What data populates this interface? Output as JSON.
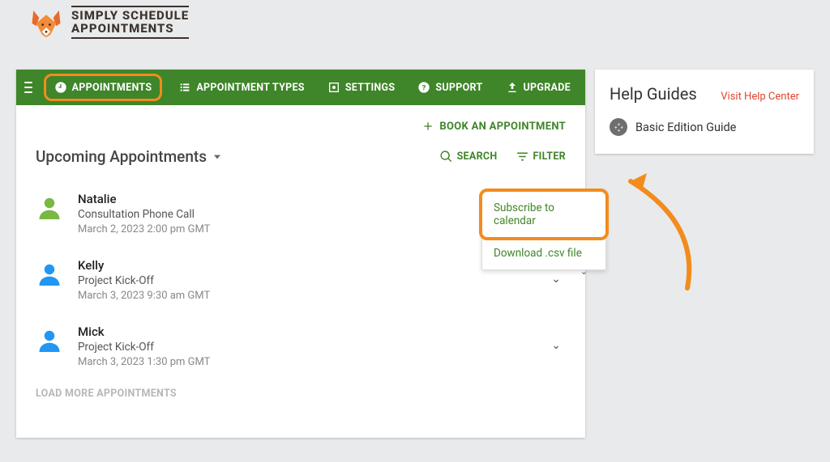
{
  "brand": {
    "line1": "SIMPLY SCHEDULE",
    "line2": "APPOINTMENTS"
  },
  "nav": {
    "appointments": "APPOINTMENTS",
    "types": "APPOINTMENT TYPES",
    "settings": "SETTINGS",
    "support": "SUPPORT",
    "upgrade": "UPGRADE"
  },
  "book_label": "BOOK AN APPOINTMENT",
  "heading": "Upcoming Appointments",
  "actions": {
    "search": "SEARCH",
    "filter": "FILTER"
  },
  "export_menu": {
    "subscribe": "Subscribe to calendar",
    "download": "Download .csv file"
  },
  "appointments": [
    {
      "name": "Natalie",
      "type": "Consultation Phone Call",
      "time": "March 2, 2023 2:00 pm GMT",
      "avatar_color": "#78b843"
    },
    {
      "name": "Kelly",
      "type": "Project Kick-Off",
      "time": "March 3, 2023 9:30 am GMT",
      "avatar_color": "#2196f3"
    },
    {
      "name": "Mick",
      "type": "Project Kick-Off",
      "time": "March 3, 2023 1:30 pm GMT",
      "avatar_color": "#2196f3"
    }
  ],
  "load_more": "LOAD MORE APPOINTMENTS",
  "side": {
    "title": "Help Guides",
    "link": "Visit Help Center",
    "guide": "Basic Edition Guide"
  }
}
